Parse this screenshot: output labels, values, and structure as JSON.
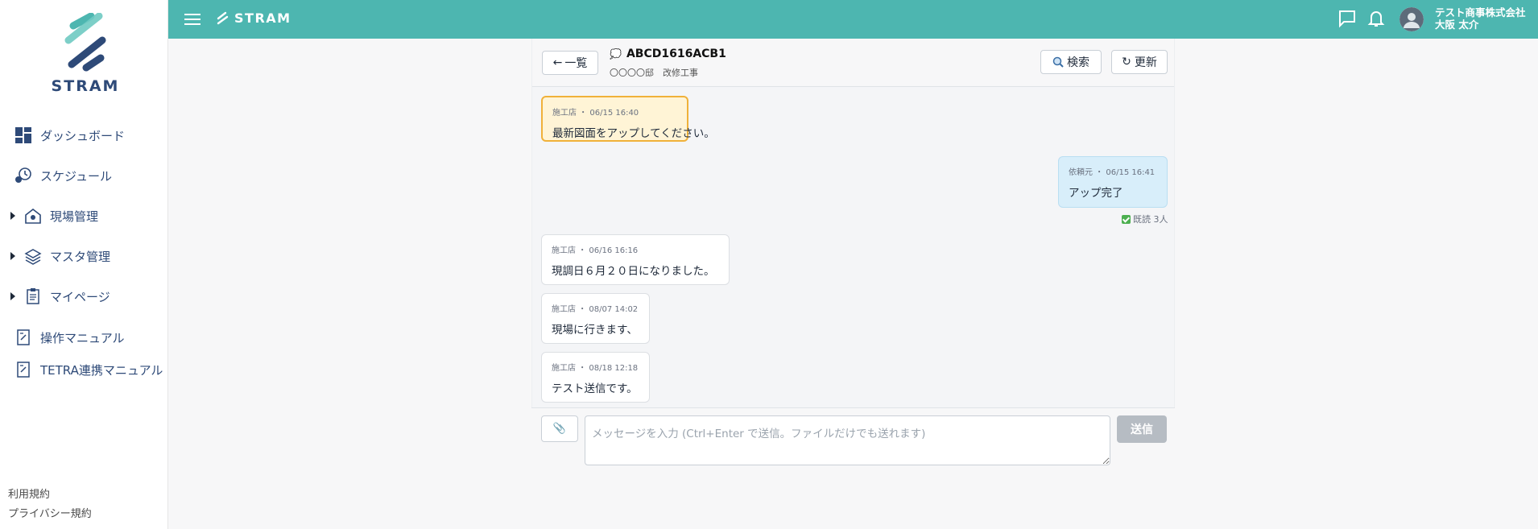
{
  "sidebar": {
    "logo_text": "STRAM",
    "items": [
      {
        "label": "ダッシュボード",
        "icon": "dashboard-icon",
        "expandable": false
      },
      {
        "label": "スケジュール",
        "icon": "schedule-icon",
        "expandable": false
      },
      {
        "label": "現場管理",
        "icon": "site-management-icon",
        "expandable": true
      },
      {
        "label": "マスタ管理",
        "icon": "layers-icon",
        "expandable": true
      },
      {
        "label": "マイページ",
        "icon": "clipboard-icon",
        "expandable": true
      },
      {
        "label": "操作マニュアル",
        "icon": "manual-icon",
        "expandable": false
      },
      {
        "label": "TETRA連携マニュアル",
        "icon": "manual-icon",
        "expandable": false
      }
    ],
    "footer": {
      "terms": "利用規約",
      "privacy": "プライバシー規約"
    }
  },
  "header": {
    "brand": "STRAM",
    "company": "テスト商事株式会社",
    "user_name": "大阪 太介",
    "colors": {
      "bar": "#4db6b0"
    }
  },
  "chat": {
    "back_label": "一覧",
    "room_icon": "💭",
    "room_title": "ABCD1616ACB1",
    "room_subtitle": "〇〇〇〇邸　改修工事",
    "search_label": "検索",
    "refresh_label": "更新",
    "messages": [
      {
        "meta": "施工店 ・ 06/15 16:40",
        "body": "最新図面をアップしてください。",
        "style": "highlight"
      },
      {
        "meta": "依頼元 ・ 06/15 16:41",
        "body": "アップ完了",
        "style": "mine",
        "read": "既読 3人"
      },
      {
        "meta": "施工店 ・ 06/16 16:16",
        "body": "現調日６月２０日になりました。",
        "style": "normal"
      },
      {
        "meta": "施工店 ・ 08/07 14:02",
        "body": "現場に行きます、",
        "style": "normal"
      },
      {
        "meta": "施工店 ・ 08/18 12:18",
        "body": "テスト送信です。",
        "style": "normal"
      }
    ],
    "composer": {
      "placeholder": "メッセージを入力 (Ctrl+Enter で送信。ファイルだけでも送れます)",
      "value": "",
      "send_label": "送信",
      "attach_icon": "📎"
    }
  }
}
